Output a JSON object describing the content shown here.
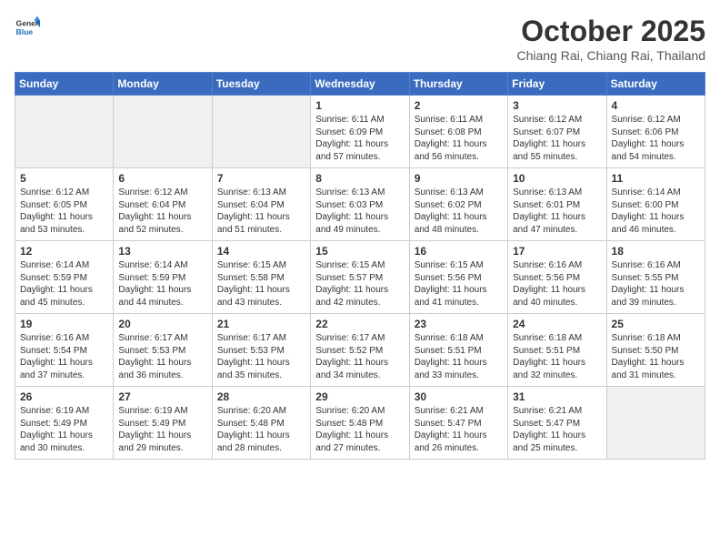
{
  "header": {
    "logo_general": "General",
    "logo_blue": "Blue",
    "title": "October 2025",
    "subtitle": "Chiang Rai, Chiang Rai, Thailand"
  },
  "days_of_week": [
    "Sunday",
    "Monday",
    "Tuesday",
    "Wednesday",
    "Thursday",
    "Friday",
    "Saturday"
  ],
  "weeks": [
    [
      {
        "day": "",
        "empty": true
      },
      {
        "day": "",
        "empty": true
      },
      {
        "day": "",
        "empty": true
      },
      {
        "day": "1",
        "sunrise": "6:11 AM",
        "sunset": "6:09 PM",
        "daylight": "11 hours and 57 minutes."
      },
      {
        "day": "2",
        "sunrise": "6:11 AM",
        "sunset": "6:08 PM",
        "daylight": "11 hours and 56 minutes."
      },
      {
        "day": "3",
        "sunrise": "6:12 AM",
        "sunset": "6:07 PM",
        "daylight": "11 hours and 55 minutes."
      },
      {
        "day": "4",
        "sunrise": "6:12 AM",
        "sunset": "6:06 PM",
        "daylight": "11 hours and 54 minutes."
      }
    ],
    [
      {
        "day": "5",
        "sunrise": "6:12 AM",
        "sunset": "6:05 PM",
        "daylight": "11 hours and 53 minutes."
      },
      {
        "day": "6",
        "sunrise": "6:12 AM",
        "sunset": "6:04 PM",
        "daylight": "11 hours and 52 minutes."
      },
      {
        "day": "7",
        "sunrise": "6:13 AM",
        "sunset": "6:04 PM",
        "daylight": "11 hours and 51 minutes."
      },
      {
        "day": "8",
        "sunrise": "6:13 AM",
        "sunset": "6:03 PM",
        "daylight": "11 hours and 49 minutes."
      },
      {
        "day": "9",
        "sunrise": "6:13 AM",
        "sunset": "6:02 PM",
        "daylight": "11 hours and 48 minutes."
      },
      {
        "day": "10",
        "sunrise": "6:13 AM",
        "sunset": "6:01 PM",
        "daylight": "11 hours and 47 minutes."
      },
      {
        "day": "11",
        "sunrise": "6:14 AM",
        "sunset": "6:00 PM",
        "daylight": "11 hours and 46 minutes."
      }
    ],
    [
      {
        "day": "12",
        "sunrise": "6:14 AM",
        "sunset": "5:59 PM",
        "daylight": "11 hours and 45 minutes."
      },
      {
        "day": "13",
        "sunrise": "6:14 AM",
        "sunset": "5:59 PM",
        "daylight": "11 hours and 44 minutes."
      },
      {
        "day": "14",
        "sunrise": "6:15 AM",
        "sunset": "5:58 PM",
        "daylight": "11 hours and 43 minutes."
      },
      {
        "day": "15",
        "sunrise": "6:15 AM",
        "sunset": "5:57 PM",
        "daylight": "11 hours and 42 minutes."
      },
      {
        "day": "16",
        "sunrise": "6:15 AM",
        "sunset": "5:56 PM",
        "daylight": "11 hours and 41 minutes."
      },
      {
        "day": "17",
        "sunrise": "6:16 AM",
        "sunset": "5:56 PM",
        "daylight": "11 hours and 40 minutes."
      },
      {
        "day": "18",
        "sunrise": "6:16 AM",
        "sunset": "5:55 PM",
        "daylight": "11 hours and 39 minutes."
      }
    ],
    [
      {
        "day": "19",
        "sunrise": "6:16 AM",
        "sunset": "5:54 PM",
        "daylight": "11 hours and 37 minutes."
      },
      {
        "day": "20",
        "sunrise": "6:17 AM",
        "sunset": "5:53 PM",
        "daylight": "11 hours and 36 minutes."
      },
      {
        "day": "21",
        "sunrise": "6:17 AM",
        "sunset": "5:53 PM",
        "daylight": "11 hours and 35 minutes."
      },
      {
        "day": "22",
        "sunrise": "6:17 AM",
        "sunset": "5:52 PM",
        "daylight": "11 hours and 34 minutes."
      },
      {
        "day": "23",
        "sunrise": "6:18 AM",
        "sunset": "5:51 PM",
        "daylight": "11 hours and 33 minutes."
      },
      {
        "day": "24",
        "sunrise": "6:18 AM",
        "sunset": "5:51 PM",
        "daylight": "11 hours and 32 minutes."
      },
      {
        "day": "25",
        "sunrise": "6:18 AM",
        "sunset": "5:50 PM",
        "daylight": "11 hours and 31 minutes."
      }
    ],
    [
      {
        "day": "26",
        "sunrise": "6:19 AM",
        "sunset": "5:49 PM",
        "daylight": "11 hours and 30 minutes."
      },
      {
        "day": "27",
        "sunrise": "6:19 AM",
        "sunset": "5:49 PM",
        "daylight": "11 hours and 29 minutes."
      },
      {
        "day": "28",
        "sunrise": "6:20 AM",
        "sunset": "5:48 PM",
        "daylight": "11 hours and 28 minutes."
      },
      {
        "day": "29",
        "sunrise": "6:20 AM",
        "sunset": "5:48 PM",
        "daylight": "11 hours and 27 minutes."
      },
      {
        "day": "30",
        "sunrise": "6:21 AM",
        "sunset": "5:47 PM",
        "daylight": "11 hours and 26 minutes."
      },
      {
        "day": "31",
        "sunrise": "6:21 AM",
        "sunset": "5:47 PM",
        "daylight": "11 hours and 25 minutes."
      },
      {
        "day": "",
        "empty": true
      }
    ]
  ]
}
